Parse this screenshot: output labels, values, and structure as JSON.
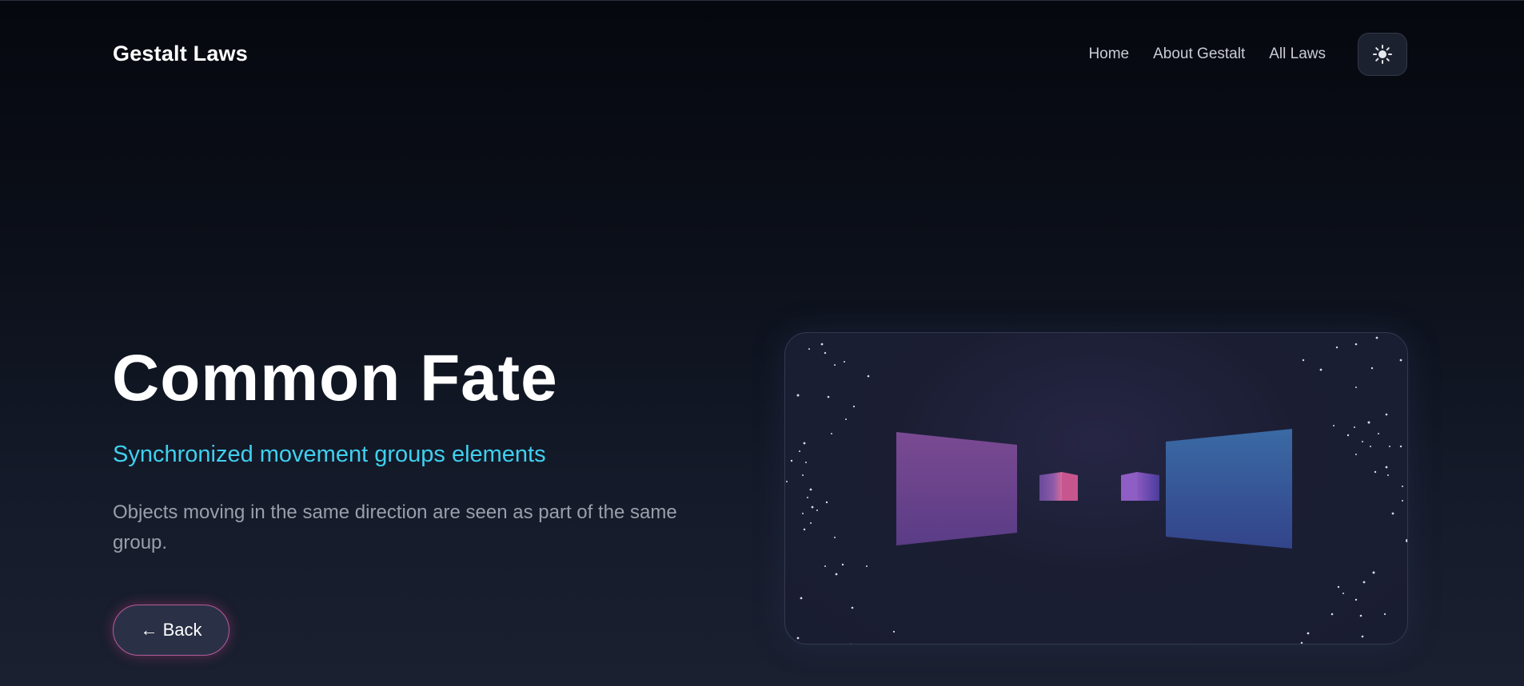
{
  "nav": {
    "brand": "Gestalt Laws",
    "links": [
      {
        "label": "Home"
      },
      {
        "label": "About Gestalt"
      },
      {
        "label": "All Laws"
      }
    ],
    "theme_toggle_icon": "sun-icon"
  },
  "hero": {
    "title": "Common Fate",
    "subtitle": "Synchronized movement groups elements",
    "description": "Objects moving in the same direction are seen as part of the same group.",
    "back_label": "← Back"
  },
  "scene": {
    "icon": "3d-moving-panels-illustration"
  },
  "colors": {
    "accent_cyan": "#3fd0ef",
    "accent_pink": "#ec4899",
    "background_dark": "#0b0f19"
  }
}
